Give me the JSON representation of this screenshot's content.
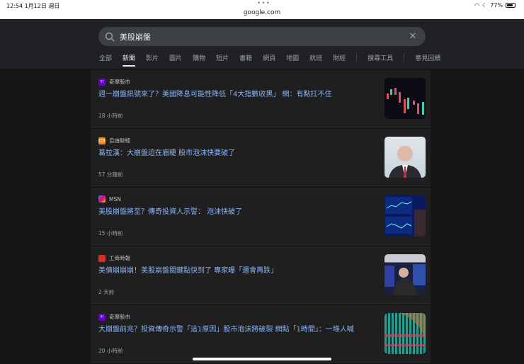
{
  "status": {
    "time": "12:54  1月12日 週日",
    "battery": "77%",
    "url": "google.com"
  },
  "search": {
    "query": "美股崩盤"
  },
  "tabs": [
    "全部",
    "新聞",
    "影片",
    "圖片",
    "購物",
    "短片",
    "書籍",
    "網頁",
    "地圖",
    "航班",
    "財經"
  ],
  "tools": {
    "search_tools": "搜尋工具",
    "feedback": "意見回饋"
  },
  "articles": [
    {
      "source": "奇摩股市",
      "title": "週一崩盤訊號來了？美國降息可能性降低「4大指數收黑」 網：有點扛不住",
      "time": "18 小時前",
      "logo_color": "#6001d2",
      "logo": "Y!"
    },
    {
      "source": "自由財經",
      "title": "葛拉漢：大崩盤迫在眉睫 股市泡沫快要破了",
      "time": "57 分鐘前",
      "logo_color": "#f08a24",
      "logo": "LTN"
    },
    {
      "source": "MSN",
      "title": "美股崩盤將至？傳奇投資人示警： 泡沫快破了",
      "time": "15 小時前",
      "logo_color": "#2b88d8",
      "logo": ""
    },
    {
      "source": "工商時報",
      "title": "美債崩崩崩！美股崩盤關鍵點快到了 專家曝「還會再跌」",
      "time": "2 天前",
      "logo_color": "#d93025",
      "logo": ""
    },
    {
      "source": "奇摩股市",
      "title": "大崩盤前兆？投資傳奇示警「這1原因」股市泡沫將破裂 網點「1時間」：一堆人喊",
      "time": "20 小時前",
      "logo_color": "#6001d2",
      "logo": "Y!"
    }
  ]
}
